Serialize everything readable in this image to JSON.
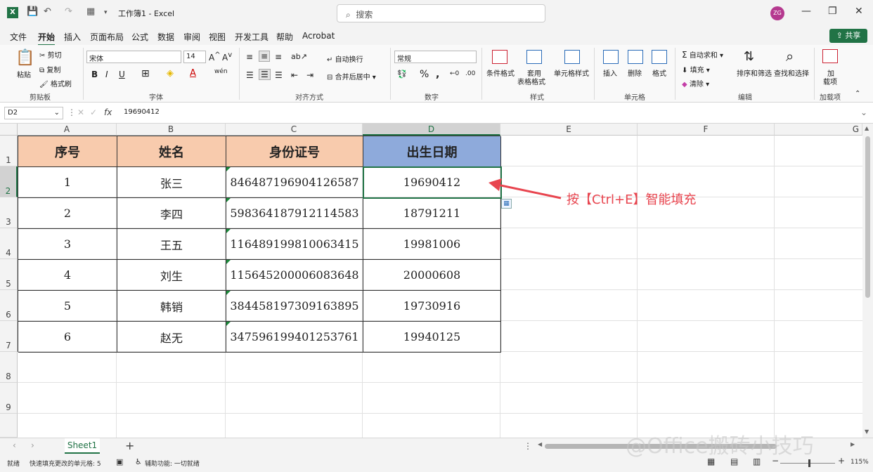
{
  "titlebar": {
    "title": "工作簿1 - Excel",
    "search_placeholder": "搜索",
    "avatar": "ZG"
  },
  "menu": {
    "items": [
      "文件",
      "开始",
      "插入",
      "页面布局",
      "公式",
      "数据",
      "审阅",
      "视图",
      "开发工具",
      "帮助",
      "Acrobat"
    ],
    "share": "共享"
  },
  "ribbon": {
    "clipboard": {
      "paste": "粘贴",
      "cut": "剪切",
      "copy": "复制",
      "format_painter": "格式刷",
      "group": "剪贴板"
    },
    "font": {
      "name": "宋体",
      "size": "14",
      "group": "字体"
    },
    "align": {
      "wrap": "自动换行",
      "merge": "合并后居中",
      "group": "对齐方式"
    },
    "number": {
      "format": "常规",
      "group": "数字"
    },
    "styles": {
      "cond": "条件格式",
      "table1": "套用",
      "table2": "表格格式",
      "cell": "单元格样式",
      "group": "样式"
    },
    "cells": {
      "insert": "插入",
      "delete": "删除",
      "format": "格式",
      "group": "单元格"
    },
    "editing": {
      "autosum": "自动求和",
      "fill": "填充",
      "clear": "清除",
      "sort": "排序和筛选",
      "find": "查找和选择",
      "group": "编辑"
    },
    "addins": {
      "label1": "加",
      "label2": "载项",
      "group": "加载项"
    }
  },
  "formula": {
    "namebox": "D2",
    "fx": "fx",
    "value": "19690412"
  },
  "columns": [
    "A",
    "B",
    "C",
    "D",
    "E",
    "F",
    "G"
  ],
  "rows": [
    "1",
    "2",
    "3",
    "4",
    "5",
    "6",
    "7",
    "8",
    "9"
  ],
  "table": {
    "headers": [
      "序号",
      "姓名",
      "身份证号",
      "出生日期"
    ],
    "rows": [
      [
        "1",
        "张三",
        "846487196904126587",
        "19690412"
      ],
      [
        "2",
        "李四",
        "598364187912114583",
        "18791211"
      ],
      [
        "3",
        "王五",
        "116489199810063415",
        "19981006"
      ],
      [
        "4",
        "刘生",
        "115645200006083648",
        "20000608"
      ],
      [
        "5",
        "韩销",
        "384458197309163895",
        "19730916"
      ],
      [
        "6",
        "赵无",
        "347596199401253761",
        "19940125"
      ]
    ]
  },
  "annotation": "按【Ctrl+E】智能填充",
  "sheet": {
    "tab": "Sheet1",
    "add": "+"
  },
  "status": {
    "ready": "就绪",
    "flash": "快速填充更改的单元格: 5",
    "access": "辅助功能: 一切就绪",
    "zoom": "115%"
  },
  "watermark": "@Office搬砖小技巧",
  "colors": {
    "header_orange": "#f8cbad",
    "header_blue": "#8eaadb",
    "excel_green": "#217346",
    "arrow_red": "#e8454f"
  }
}
